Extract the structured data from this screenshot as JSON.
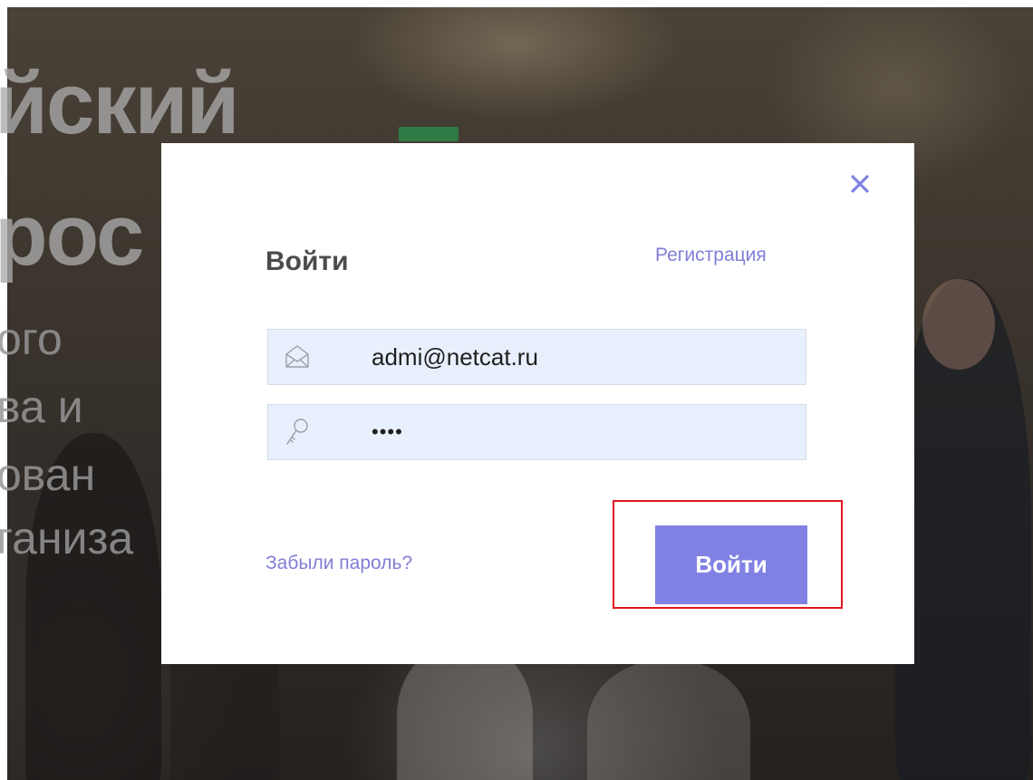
{
  "background": {
    "hero_lines": [
      "йский",
      "рос",
      "ого",
      "ва и",
      "ован",
      "ганиза"
    ]
  },
  "login_modal": {
    "title": "Войти",
    "register_link": "Регистрация",
    "email": {
      "value": "admi@netcat.ru",
      "icon": "envelope-icon"
    },
    "password": {
      "value": "****",
      "icon": "key-icon"
    },
    "forgot_link": "Забыли пароль?",
    "submit_label": "Войти",
    "close_icon": "close-icon"
  },
  "colors": {
    "accent": "#8181e4",
    "link": "#7f7fd6",
    "title": "#4b4b4b",
    "field_bg": "#e8f0fd",
    "highlight": "#e0161d"
  }
}
